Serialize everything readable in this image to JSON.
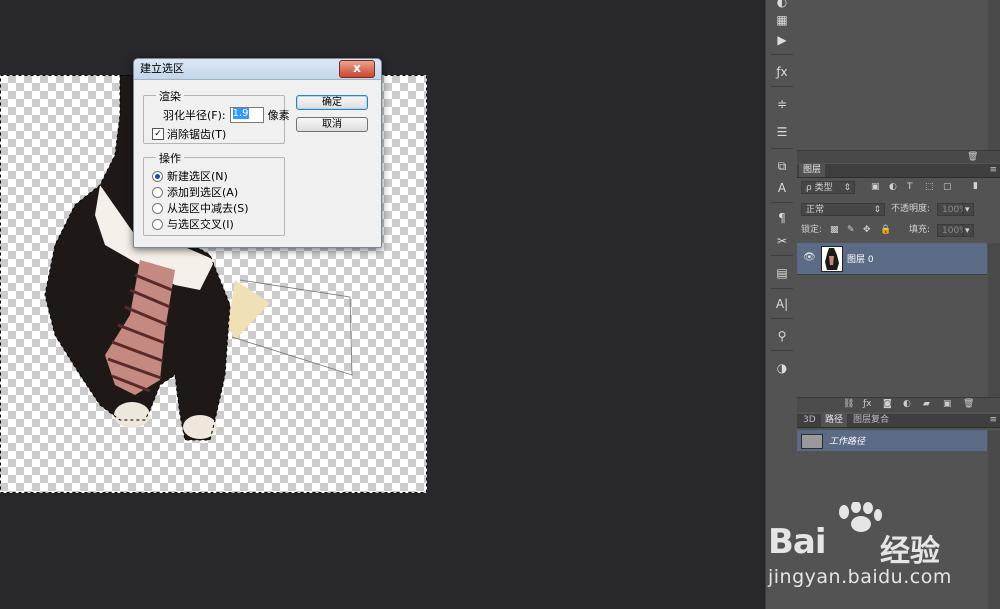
{
  "dialog": {
    "title": "建立选区",
    "close_label": "x",
    "render_group": "渲染",
    "feather_label": "羽化半径(F):",
    "feather_value": "1.9",
    "feather_unit": "像素",
    "antialias_label": "消除锯齿(T)",
    "antialias_checked": true,
    "operation_group": "操作",
    "operations": [
      {
        "label": "新建选区(N)",
        "selected": true
      },
      {
        "label": "添加到选区(A)",
        "selected": false
      },
      {
        "label": "从选区中减去(S)",
        "selected": false
      },
      {
        "label": "与选区交叉(I)",
        "selected": false
      }
    ],
    "ok_label": "确定",
    "cancel_label": "取消"
  },
  "layers_panel": {
    "tab_label": "图层",
    "filter_label": "ρ 类型",
    "blend_mode": "正常",
    "opacity_label": "不透明度:",
    "opacity_value": "100%",
    "lock_label": "锁定:",
    "fill_label": "填充:",
    "fill_value": "100%",
    "layers": [
      {
        "name": "图层 0",
        "visible": true,
        "selected": true
      }
    ]
  },
  "bottom_panel": {
    "tabs": [
      "3D",
      "路径",
      "图层复合"
    ],
    "active_tab": "路径",
    "paths": [
      {
        "name": "工作路径",
        "selected": true
      }
    ]
  },
  "watermark": {
    "brand": "Bai",
    "brand_cn": "经验",
    "url": "jingyan.baidu.com"
  },
  "colors": {
    "workspace_bg": "#28272b",
    "panel_bg": "#535353",
    "selected_row": "#5b6b86",
    "dialog_bg": "#f0f0f0"
  }
}
